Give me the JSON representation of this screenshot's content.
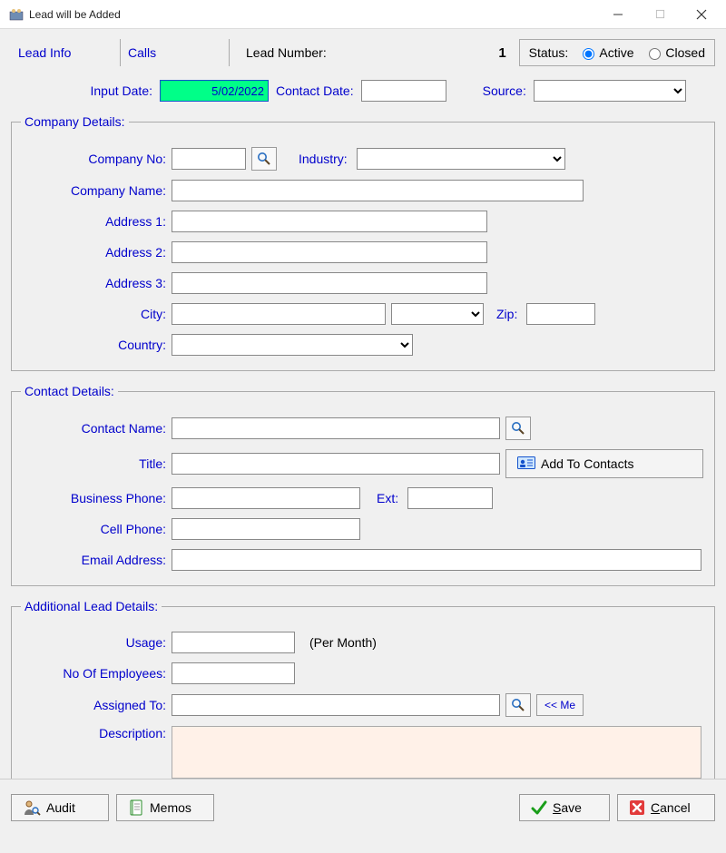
{
  "window": {
    "title": "Lead will be Added"
  },
  "tabs": {
    "lead_info": "Lead Info",
    "calls": "Calls"
  },
  "header": {
    "lead_number_label": "Lead Number:",
    "lead_number_value": "1",
    "status_label": "Status:",
    "status_active": "Active",
    "status_closed": "Closed"
  },
  "meta": {
    "input_date_label": "Input Date:",
    "input_date_value": "5/02/2022",
    "contact_date_label": "Contact Date:",
    "contact_date_value": "",
    "source_label": "Source:",
    "source_value": ""
  },
  "company": {
    "legend": "Company Details:",
    "company_no_label": "Company No:",
    "company_no_value": "",
    "industry_label": "Industry:",
    "industry_value": "",
    "company_name_label": "Company Name:",
    "company_name_value": "",
    "address1_label": "Address 1:",
    "address1_value": "",
    "address2_label": "Address 2:",
    "address2_value": "",
    "address3_label": "Address 3:",
    "address3_value": "",
    "city_label": "City:",
    "city_value": "",
    "state_value": "",
    "zip_label": "Zip:",
    "zip_value": "",
    "country_label": "Country:",
    "country_value": ""
  },
  "contact": {
    "legend": "Contact Details:",
    "contact_name_label": "Contact Name:",
    "contact_name_value": "",
    "title_label": "Title:",
    "title_value": "",
    "add_to_contacts": "Add To Contacts",
    "business_phone_label": "Business Phone:",
    "business_phone_value": "",
    "ext_label": "Ext:",
    "ext_value": "",
    "cell_phone_label": "Cell Phone:",
    "cell_phone_value": "",
    "email_label": "Email Address:",
    "email_value": ""
  },
  "additional": {
    "legend": "Additional Lead Details:",
    "usage_label": "Usage:",
    "usage_value": "",
    "usage_unit": "(Per Month)",
    "employees_label": "No Of Employees:",
    "employees_value": "",
    "assigned_label": "Assigned To:",
    "assigned_value": "",
    "me_button": "<< Me",
    "description_label": "Description:",
    "description_value": ""
  },
  "footer": {
    "audit": "Audit",
    "memos": "Memos",
    "save_pre": "",
    "save_ul": "S",
    "save_post": "ave",
    "cancel_pre": "",
    "cancel_ul": "C",
    "cancel_post": "ancel"
  }
}
